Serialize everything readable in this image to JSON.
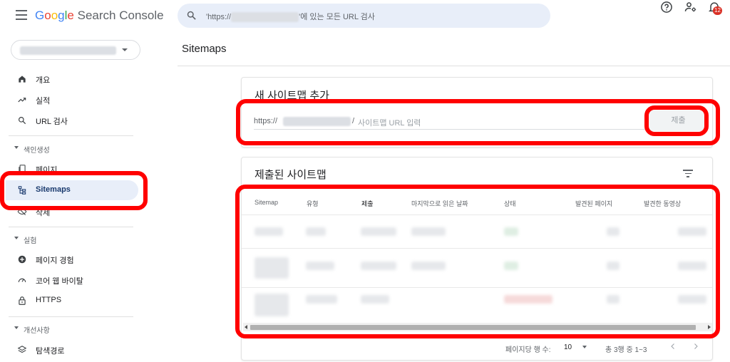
{
  "app": {
    "logo_google": "Google",
    "logo_product": "Search Console",
    "search_prefix": "'https://",
    "search_suffix": "'에 있는 모든 URL 검사",
    "notification_count": "12",
    "icons": [
      "menu-icon",
      "search-icon",
      "help-icon",
      "manage-users-icon",
      "bell-icon"
    ]
  },
  "sidebar": {
    "items": [
      {
        "label": "개요",
        "icon": "home-icon"
      },
      {
        "label": "실적",
        "icon": "trending-icon"
      },
      {
        "label": "URL 검사",
        "icon": "search-icon"
      }
    ],
    "sections": [
      {
        "label": "색인생성",
        "items": [
          {
            "label": "페이지",
            "icon": "pages-icon"
          },
          {
            "label": "Sitemaps",
            "icon": "sitemap-icon",
            "active": true
          },
          {
            "label": "삭제",
            "icon": "removal-icon"
          }
        ]
      },
      {
        "label": "실험",
        "items": [
          {
            "label": "페이지 경험",
            "icon": "plus-circle-icon"
          },
          {
            "label": "코어 웹 바이탈",
            "icon": "gauge-icon"
          },
          {
            "label": "HTTPS",
            "icon": "lock-icon"
          }
        ]
      },
      {
        "label": "개선사항",
        "items": [
          {
            "label": "탐색경로",
            "icon": "layers-icon"
          }
        ]
      }
    ]
  },
  "main": {
    "page_title": "Sitemaps",
    "add_card": {
      "title": "새 사이트맵 추가",
      "url_prefix": "https://",
      "url_slash": "/",
      "input_placeholder": "사이트맵 URL 입력",
      "submit_label": "제출"
    },
    "submitted_card": {
      "title": "제출된 사이트맵",
      "columns": [
        "Sitemap",
        "유형",
        "제출",
        "마지막으로 읽은 날짜",
        "상태",
        "발견된 페이지",
        "발견한 동영상"
      ],
      "sorted_column_arrow": "↓"
    },
    "pagination": {
      "rows_per_page_label": "페이지당 행 수:",
      "rows_per_page_value": "10",
      "range_label": "총 3행 중 1~3"
    }
  },
  "colors": {
    "highlight": "#ff0000",
    "active_nav_bg": "#e8eef9",
    "badge": "#d93025"
  }
}
